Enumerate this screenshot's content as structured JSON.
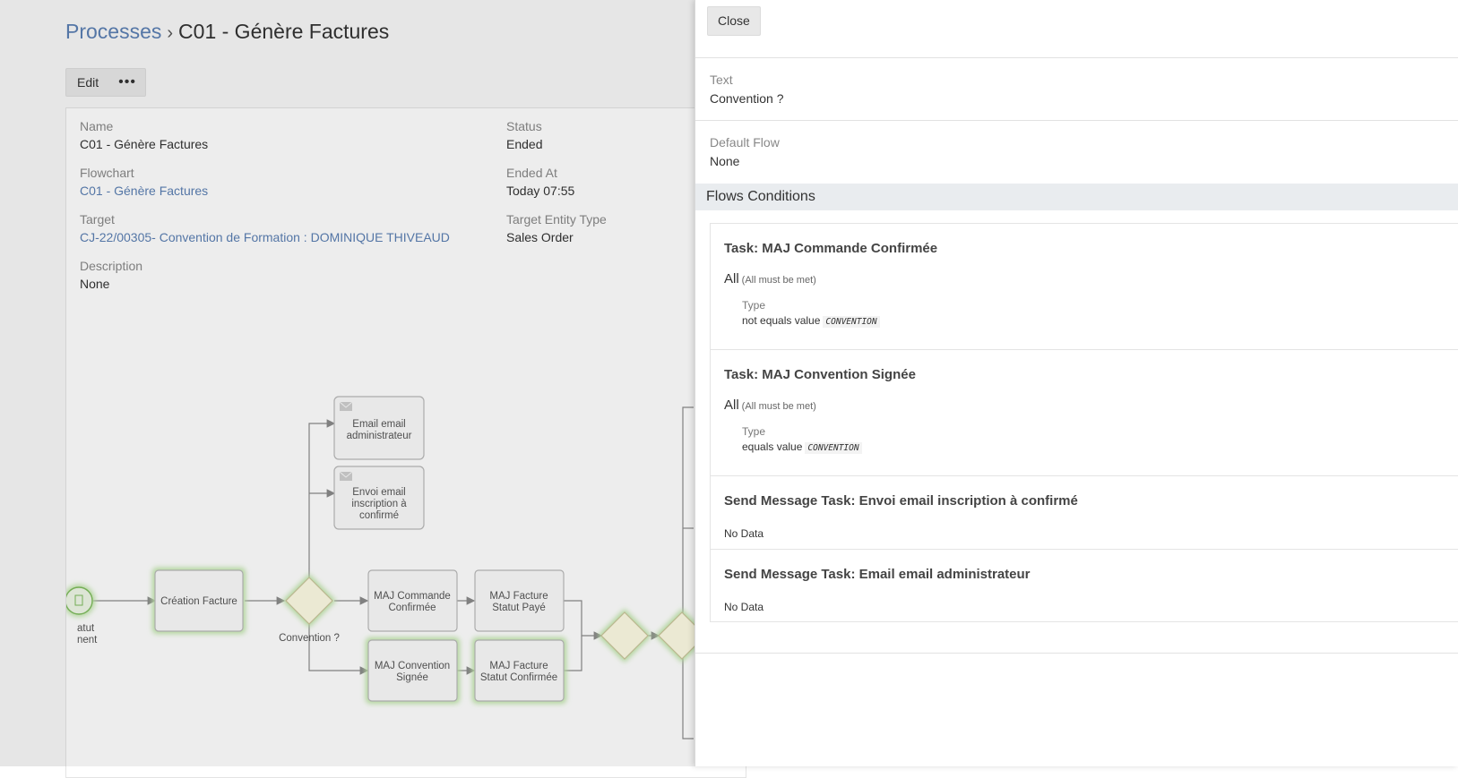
{
  "breadcrumb": {
    "root": "Processes",
    "separator": "›",
    "current": "C01 - Génère Factures"
  },
  "actions": {
    "edit_label": "Edit",
    "more_label": "•••"
  },
  "details": {
    "name_label": "Name",
    "name_value": "C01 - Génère Factures",
    "flowchart_label": "Flowchart",
    "flowchart_value": "C01 - Génère Factures",
    "target_label": "Target",
    "target_value": "CJ-22/00305- Convention de Formation : DOMINIQUE THIVEAUD",
    "description_label": "Description",
    "description_value": "None",
    "status_label": "Status",
    "status_value": "Ended",
    "ended_at_label": "Ended At",
    "ended_at_value": "Today 07:55",
    "target_entity_label": "Target Entity Type",
    "target_entity_value": "Sales Order"
  },
  "flowchart": {
    "start_label_line1": "atut",
    "start_label_line2": "nent",
    "creation": "Création Facture",
    "gateway_label": "Convention ?",
    "email_admin_line1": "Email email",
    "email_admin_line2": "administrateur",
    "envoi_line1": "Envoi email",
    "envoi_line2": "inscription à",
    "envoi_line3": "confirmé",
    "maj_cmd_line1": "MAJ Commande",
    "maj_cmd_line2": "Confirmée",
    "maj_fact_paye_line1": "MAJ Facture",
    "maj_fact_paye_line2": "Statut Payé",
    "maj_conv_line1": "MAJ Convention",
    "maj_conv_line2": "Signée",
    "maj_fact_conf_line1": "MAJ Facture",
    "maj_fact_conf_line2": "Statut Confirmée"
  },
  "drawer": {
    "close_label": "Close",
    "text_label": "Text",
    "text_value": "Convention ?",
    "default_flow_label": "Default Flow",
    "default_flow_value": "None",
    "section_title": "Flows Conditions",
    "conditions": [
      {
        "title": "Task: MAJ Commande Confirmée",
        "all": "All",
        "all_note": "(All must be met)",
        "type_label": "Type",
        "rule": "not equals value",
        "value": "CONVENTION"
      },
      {
        "title": "Task: MAJ Convention Signée",
        "all": "All",
        "all_note": "(All must be met)",
        "type_label": "Type",
        "rule": "equals value",
        "value": "CONVENTION"
      },
      {
        "title": "Send Message Task: Envoi email inscription à confirmé",
        "no_data": "No Data"
      },
      {
        "title": "Send Message Task: Email email administrateur",
        "no_data": "No Data"
      }
    ]
  },
  "colors": {
    "link": "#5b7fb3",
    "gateway_fill": "#fdfbe3",
    "glow": "#bfe6a8",
    "section_bg": "#e9ecef"
  }
}
